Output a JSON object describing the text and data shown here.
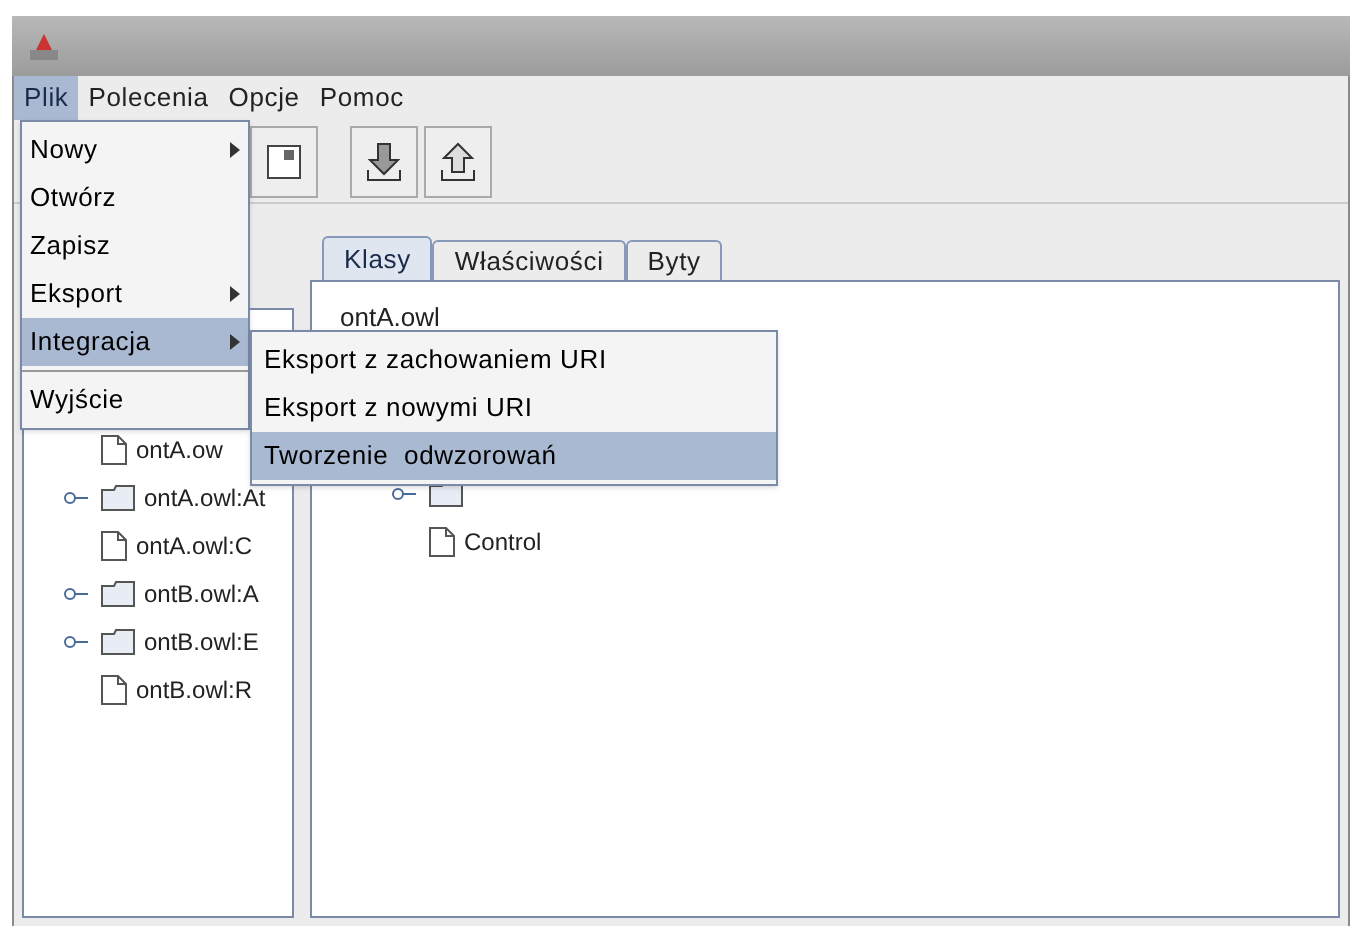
{
  "menubar": [
    {
      "label": "Plik",
      "selected": true
    },
    {
      "label": "Polecenia",
      "selected": false
    },
    {
      "label": "Opcje",
      "selected": false
    },
    {
      "label": "Pomoc",
      "selected": false
    }
  ],
  "file_menu": [
    {
      "label": "Nowy",
      "submenu": true,
      "selected": false,
      "separator_before": false
    },
    {
      "label": "Otwórz",
      "submenu": false,
      "selected": false,
      "separator_before": false
    },
    {
      "label": "Zapisz",
      "submenu": false,
      "selected": false,
      "separator_before": false
    },
    {
      "label": "Eksport",
      "submenu": true,
      "selected": false,
      "separator_before": false
    },
    {
      "label": "Integracja",
      "submenu": true,
      "selected": true,
      "separator_before": false
    },
    {
      "label": "Wyjście",
      "submenu": false,
      "selected": false,
      "separator_before": true
    }
  ],
  "integration_submenu": [
    {
      "label": "Eksport z zachowaniem URI",
      "selected": false
    },
    {
      "label": "Eksport z nowymi URI",
      "selected": false
    },
    {
      "label": "Tworzenie  odwzorowań",
      "selected": true
    }
  ],
  "left_tree": [
    {
      "label": "ontA.ow",
      "kind": "file"
    },
    {
      "label": "ontA.owl:At",
      "kind": "folder"
    },
    {
      "label": "ontA.owl:C",
      "kind": "file"
    },
    {
      "label": "ontB.owl:A",
      "kind": "folder"
    },
    {
      "label": "ontB.owl:E",
      "kind": "folder"
    },
    {
      "label": "ontB.owl:R",
      "kind": "file"
    }
  ],
  "tabs": [
    {
      "label": "Klasy",
      "selected": true
    },
    {
      "label": "Właściwości",
      "selected": false
    },
    {
      "label": "Byty",
      "selected": false
    }
  ],
  "class_tree": {
    "root": "ontA.owl",
    "children": [
      {
        "kind": "folder"
      },
      {
        "label": "Control",
        "kind": "file"
      }
    ]
  }
}
